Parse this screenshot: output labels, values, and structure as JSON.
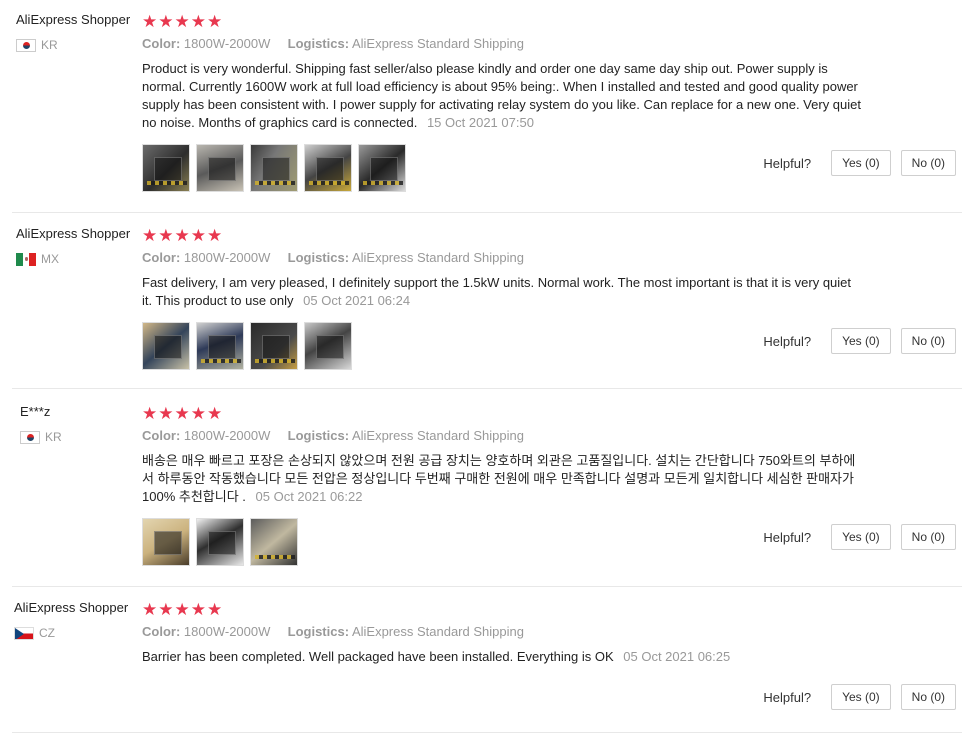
{
  "labels": {
    "color": "Color:",
    "logistics": "Logistics:",
    "helpful": "Helpful?"
  },
  "colors": {
    "star": "#e8384f",
    "meta": "#999999"
  },
  "reviews": [
    {
      "user": "AliExpress Shopper",
      "country": "KR",
      "flag": "kr-flag-icon",
      "rating": 5,
      "color": "1800W-2000W",
      "logistics": "AliExpress Standard Shipping",
      "text": "Product is very wonderful. Shipping fast seller/also please kindly and order one day same day ship out. Power supply is normal. Currently 1600W work at full load efficiency is about 95% being:. When I installed and tested and good quality power supply has been consistent with. I power supply for activating relay system do you like. Can replace for a new one. Very quiet no noise. Months of graphics card is connected.",
      "date": "15 Oct 2021 07:50",
      "photo_count": 5,
      "yes": "Yes (0)",
      "no": "No (0)"
    },
    {
      "user": "AliExpress Shopper",
      "country": "MX",
      "flag": "mx-flag-icon",
      "rating": 5,
      "color": "1800W-2000W",
      "logistics": "AliExpress Standard Shipping",
      "text": "Fast delivery, I am very pleased, I definitely support the 1.5kW units. Normal work. The most important is that it is very quiet it. This product to use only",
      "date": "05 Oct 2021 06:24",
      "photo_count": 4,
      "yes": "Yes (0)",
      "no": "No (0)"
    },
    {
      "user": "E***z",
      "country": "KR",
      "flag": "kr-flag-icon",
      "rating": 5,
      "color": "1800W-2000W",
      "logistics": "AliExpress Standard Shipping",
      "text": "배송은 매우 빠르고 포장은 손상되지 않았으며 전원 공급 장치는 양호하며 외관은 고품질입니다. 설치는 간단합니다 750와트의 부하에서 하루동안 작동했습니다 모든 전압은 정상입니다 두번째 구매한 전원에 매우 만족합니다 설명과 모든게 일치합니다 세심한 판매자가 100% 추천합니다 .",
      "date": "05 Oct 2021 06:22",
      "photo_count": 3,
      "yes": "Yes (0)",
      "no": "No (0)"
    },
    {
      "user": "AliExpress Shopper",
      "country": "CZ",
      "flag": "cz-flag-icon",
      "rating": 5,
      "color": "1800W-2000W",
      "logistics": "AliExpress Standard Shipping",
      "text": "Barrier has been completed. Well packaged have been installed. Everything is OK",
      "date": "05 Oct 2021 06:25",
      "photo_count": 0,
      "yes": "Yes (0)",
      "no": "No (0)"
    }
  ]
}
